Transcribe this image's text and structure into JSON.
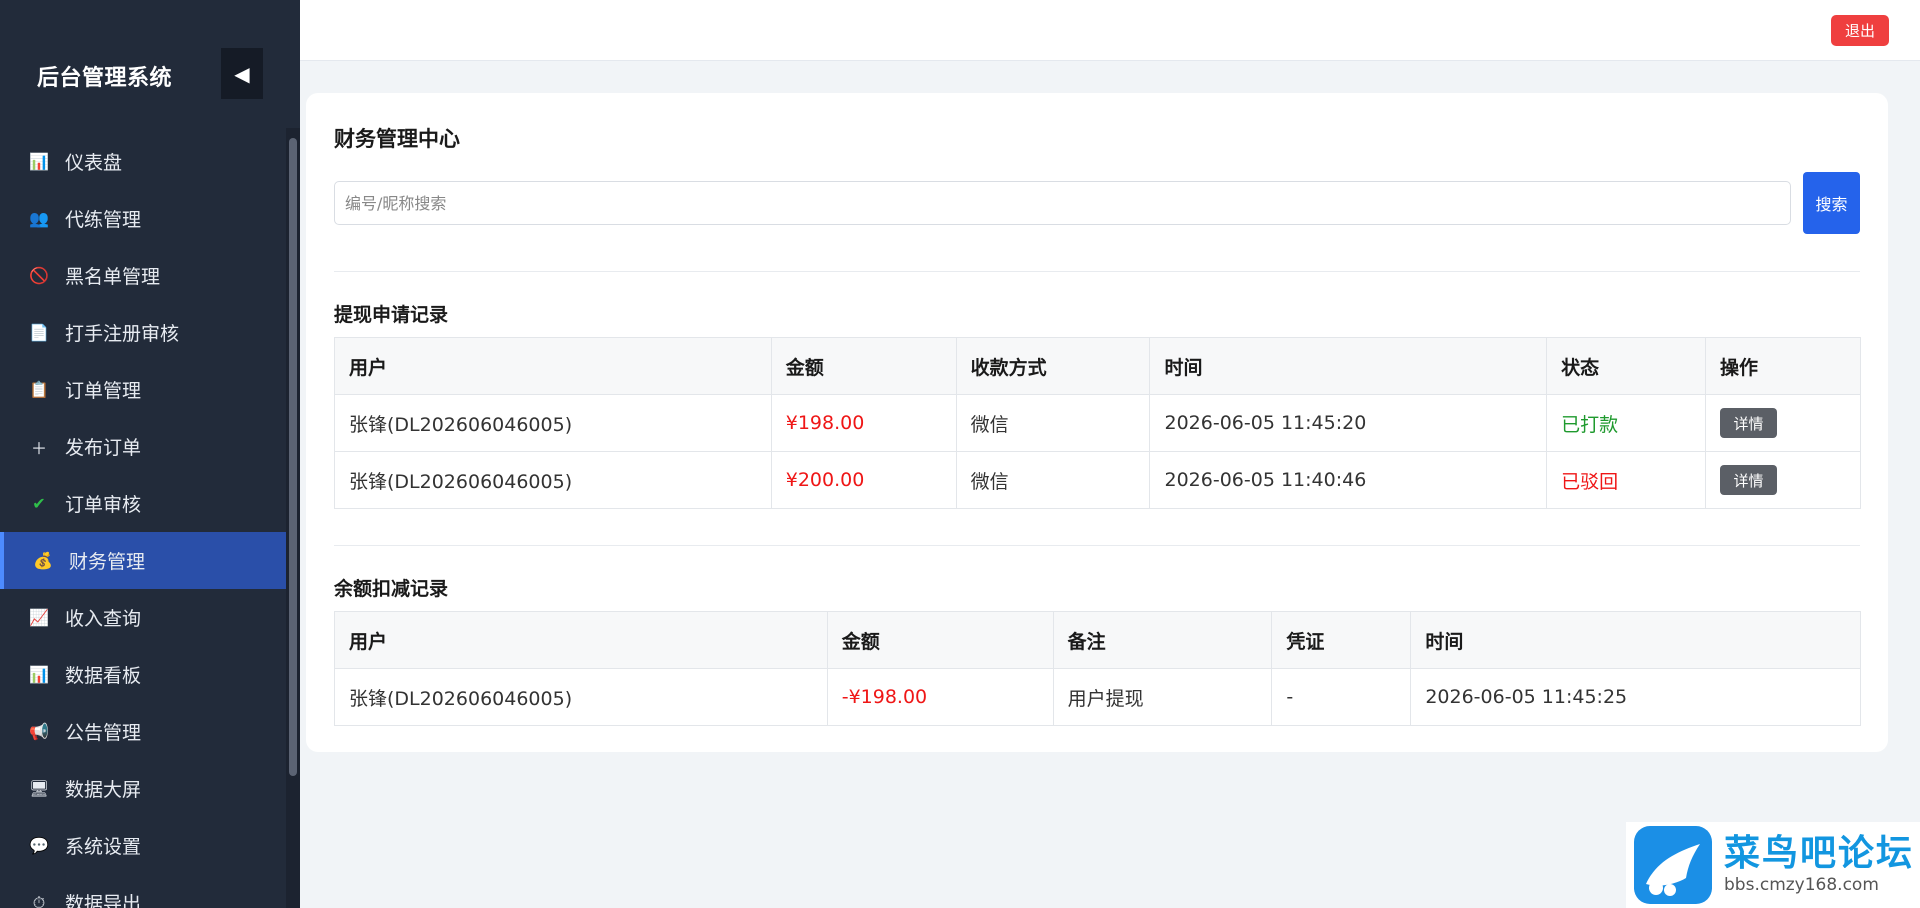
{
  "sidebar": {
    "title": "后台管理系统",
    "collapse_glyph": "◀",
    "items": [
      {
        "label": "仪表盘",
        "icon": "📊"
      },
      {
        "label": "代练管理",
        "icon": "👥"
      },
      {
        "label": "黑名单管理",
        "icon": "🚫"
      },
      {
        "label": "打手注册审核",
        "icon": "📄"
      },
      {
        "label": "订单管理",
        "icon": "📋"
      },
      {
        "label": "发布订单",
        "icon": "＋"
      },
      {
        "label": "订单审核",
        "icon": "✔"
      },
      {
        "label": "财务管理",
        "icon": "💰"
      },
      {
        "label": "收入查询",
        "icon": "📈"
      },
      {
        "label": "数据看板",
        "icon": "📊"
      },
      {
        "label": "公告管理",
        "icon": "📢"
      },
      {
        "label": "数据大屏",
        "icon": "🖥"
      },
      {
        "label": "系统设置",
        "icon": "💬"
      },
      {
        "label": "数据导出",
        "icon": "⏱"
      }
    ],
    "active_index": 7
  },
  "header": {
    "logout_label": "退出"
  },
  "main": {
    "title": "财务管理中心",
    "search": {
      "placeholder": "编号/昵称搜索",
      "button_label": "搜索"
    },
    "withdraw": {
      "title": "提现申请记录",
      "columns": [
        "用户",
        "金额",
        "收款方式",
        "时间",
        "状态",
        "操作"
      ],
      "rows": [
        {
          "user": "张锋(DL202606046005)",
          "amount": "¥198.00",
          "method": "微信",
          "time": "2026-06-05 11:45:20",
          "status": "已打款",
          "action": "详情"
        },
        {
          "user": "张锋(DL202606046005)",
          "amount": "¥200.00",
          "method": "微信",
          "time": "2026-06-05 11:40:46",
          "status": "已驳回",
          "action": "详情"
        }
      ]
    },
    "deduction": {
      "title": "余额扣减记录",
      "columns": [
        "用户",
        "金额",
        "备注",
        "凭证",
        "时间"
      ],
      "rows": [
        {
          "user": "张锋(DL202606046005)",
          "amount": "-¥198.00",
          "note": "用户提现",
          "voucher": "-",
          "time": "2026-06-05 11:45:25"
        }
      ]
    }
  },
  "watermark": {
    "name": "菜鸟吧论坛",
    "url": "bbs.cmzy168.com"
  },
  "colors": {
    "accent": "#2563eb",
    "danger": "#ef3f3f",
    "success": "#1f9a2e",
    "sidebar_bg": "#222b3a",
    "active_item": "#2a4fa9"
  }
}
